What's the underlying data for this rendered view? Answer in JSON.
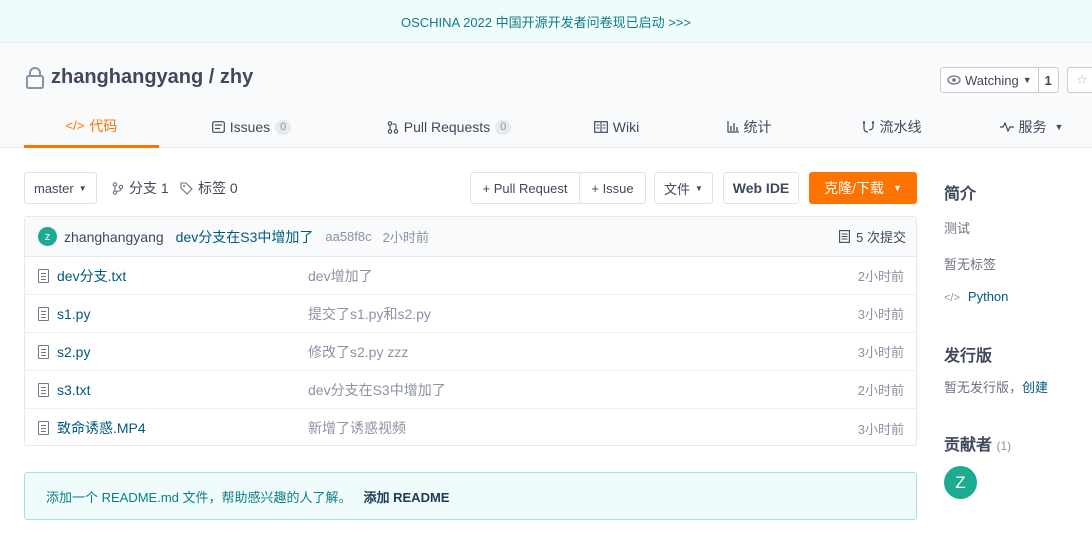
{
  "banner": {
    "text": "OSCHINA 2022 中国开源开发者问卷现已启动 >>>"
  },
  "repo": {
    "title": "zhanghangyang / zhy"
  },
  "watch": {
    "label": "Watching",
    "count": "1"
  },
  "tabs": [
    {
      "icon": "</>",
      "label": "代码",
      "active": true
    },
    {
      "label": "Issues",
      "badge": "0"
    },
    {
      "label": "Pull Requests",
      "badge": "0"
    },
    {
      "label": "Wiki"
    },
    {
      "label": "统计"
    },
    {
      "label": "流水线"
    },
    {
      "label": "服务"
    }
  ],
  "branch": {
    "selected": "master",
    "branches_label": "分支 1",
    "tags_label": "标签 0"
  },
  "actions": {
    "pull_request": "+ Pull Request",
    "issue": "+ Issue",
    "file": "文件",
    "web_ide": "Web IDE",
    "clone": "克隆/下载"
  },
  "commit": {
    "author": "zhanghangyang",
    "message": "dev分支在S3中增加了",
    "hash": "aa58f8c",
    "time": "2小时前",
    "commits": "5 次提交",
    "avatar_letter": "z"
  },
  "files": [
    {
      "name": "dev分支.txt",
      "message": "dev增加了",
      "time": "2小时前"
    },
    {
      "name": "s1.py",
      "message": "提交了s1.py和s2.py",
      "time": "3小时前"
    },
    {
      "name": "s2.py",
      "message": "修改了s2.py zzz",
      "time": "3小时前"
    },
    {
      "name": "s3.txt",
      "message": "dev分支在S3中增加了",
      "time": "2小时前"
    },
    {
      "name": "致命诱惑.MP4",
      "message": "新增了诱惑视频",
      "time": "3小时前"
    }
  ],
  "readme": {
    "text": "添加一个 README.md 文件，帮助感兴趣的人了解。",
    "link": "添加 README"
  },
  "sidebar": {
    "intro_title": "简介",
    "intro_desc": "测试",
    "no_tags": "暂无标签",
    "language": "Python",
    "release_title": "发行版",
    "no_release": "暂无发行版，",
    "create": "创建",
    "contrib_title": "贡献者",
    "contrib_count": "(1)",
    "contrib_letter": "Z"
  },
  "colors": {
    "accent": "#fe7300",
    "link": "#005980",
    "teal": "#0e7c86",
    "avatar": "#1cab8e"
  }
}
